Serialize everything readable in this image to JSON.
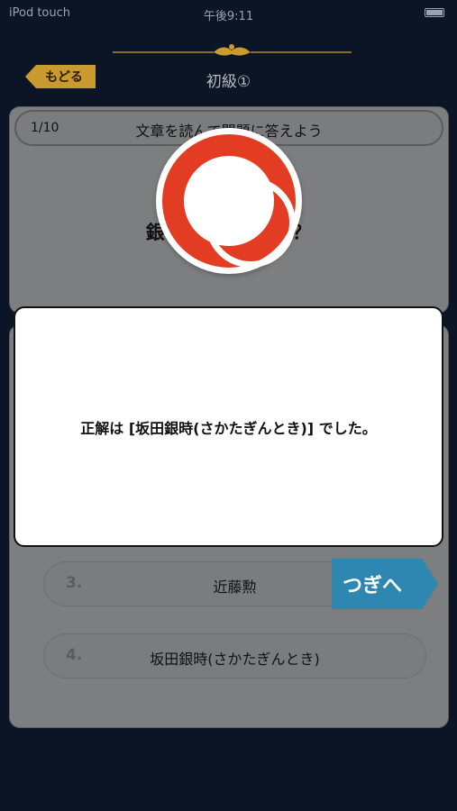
{
  "status_bar": {
    "carrier": "iPod touch",
    "time": "午後9:11"
  },
  "header": {
    "back_label": "もどる",
    "title": "初級①"
  },
  "question": {
    "progress": "1/10",
    "instruction": "文章を読んで問題に答えよう",
    "text": "銀     の主人公は？"
  },
  "choices": [
    {
      "number": "3.",
      "label": "近藤勲"
    },
    {
      "number": "4.",
      "label": "坂田銀時(さかたぎんとき)"
    }
  ],
  "next_button": {
    "label": "つぎへ"
  },
  "result_dialog": {
    "message": "正解は [坂田銀時(さかたぎんとき)] でした。"
  },
  "colors": {
    "background": "#0b1526",
    "accent_gold": "#c99a2e",
    "next_blue": "#2e87b0",
    "correct_red": "#e23d23"
  },
  "icons": {
    "correct_mark": "red-circle-correct-icon",
    "ornament": "gold-ornament-divider"
  }
}
